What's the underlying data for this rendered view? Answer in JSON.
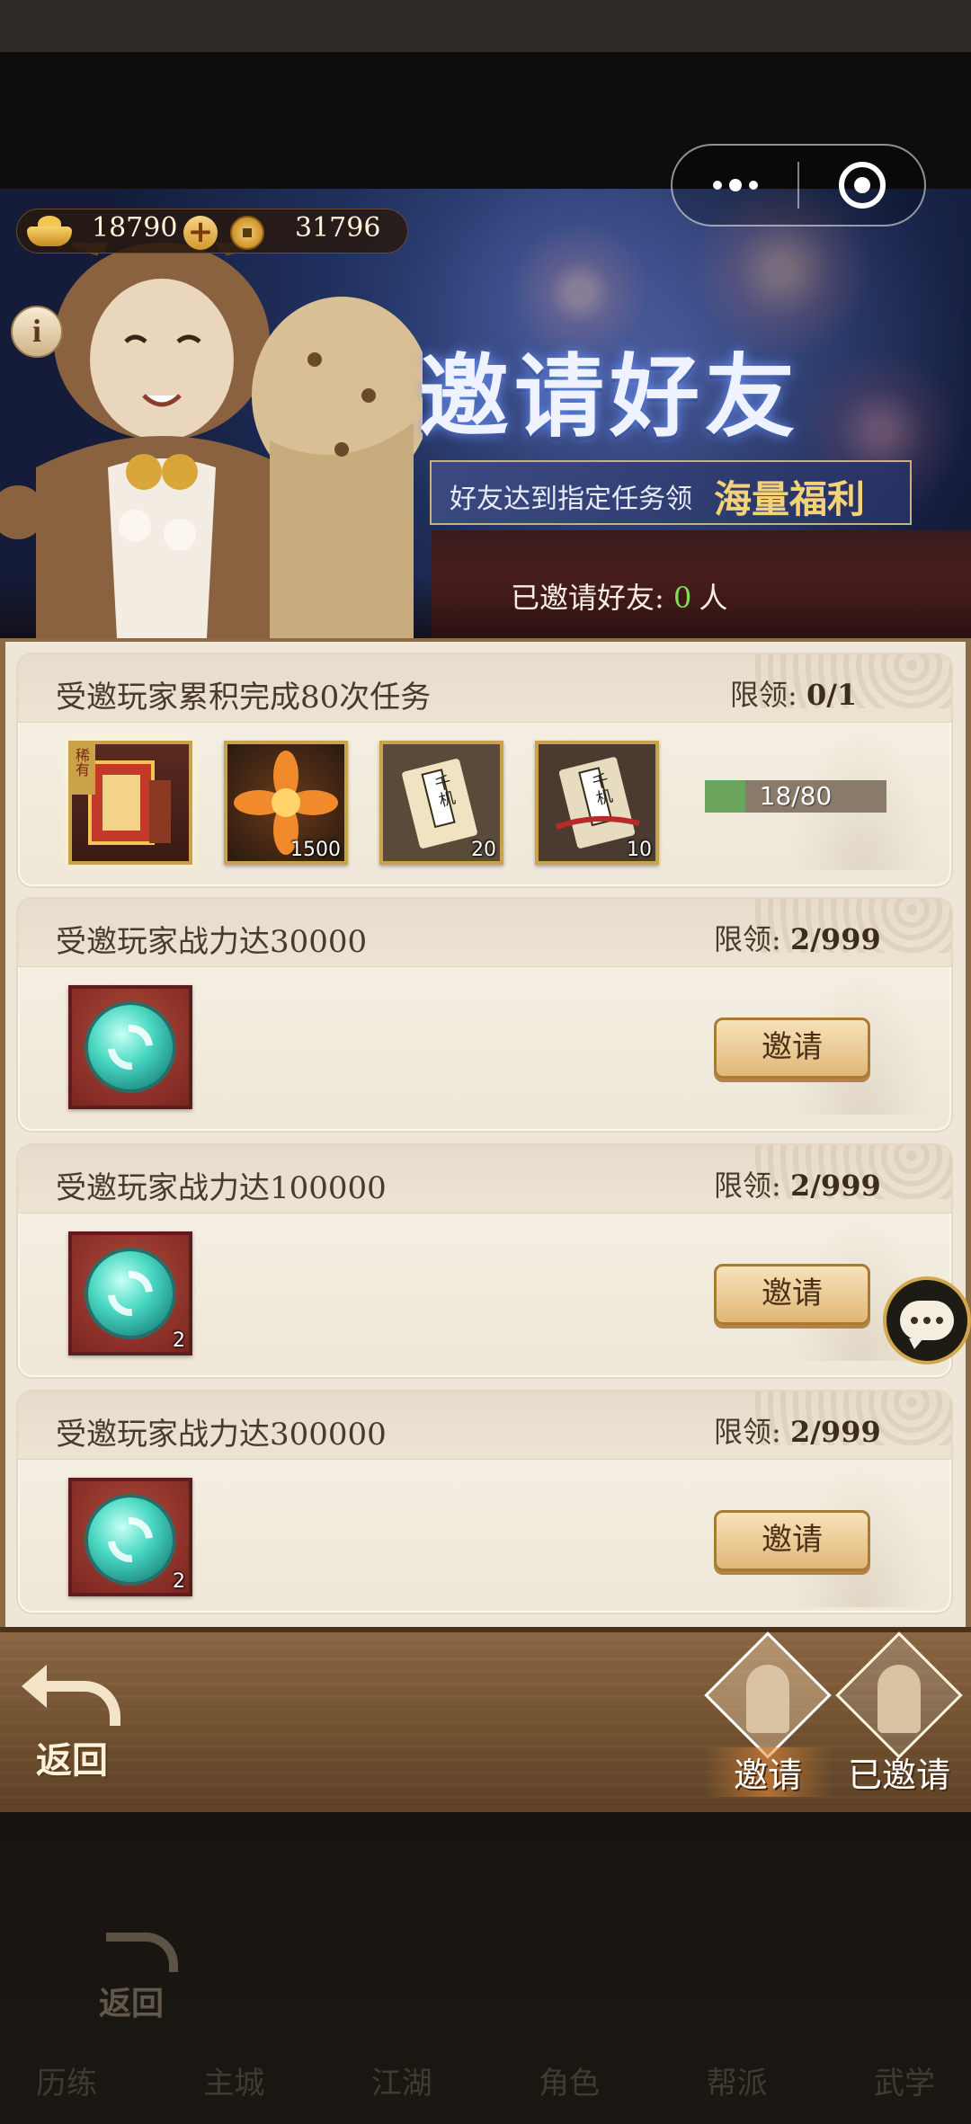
{
  "currency": {
    "gold": "18790",
    "coins": "31796",
    "gold_icon": "gold-ingot-icon",
    "coin_icon": "copper-coin-icon",
    "plus_symbol": "+"
  },
  "capsule": {
    "more_icon": "more-dots-icon",
    "close_icon": "target-close-icon"
  },
  "info_symbol": "i",
  "banner": {
    "title": "邀请好友",
    "subtitle_prefix": "好友达到指定任务领",
    "subtitle_emphasis": "海量福利",
    "invited_label": "已邀请好友: ",
    "invited_count": "0",
    "invited_unit": "人"
  },
  "limit_label": "限领:",
  "invite_label": "邀请",
  "tasks": [
    {
      "title": "受邀玩家累积完成80次任务",
      "limit": "0/1",
      "rewards": [
        {
          "icon": "rare-book-icon",
          "qty": "",
          "badge": "稀有"
        },
        {
          "icon": "flame-flower-icon",
          "qty": "1500"
        },
        {
          "icon": "scroll-card-icon",
          "qty": "20"
        },
        {
          "icon": "scroll-card-ribbon-icon",
          "qty": "10"
        }
      ],
      "progress_text": "18/80",
      "progress": 0.225
    },
    {
      "title": "受邀玩家战力达30000",
      "limit": "2/999",
      "rewards": [
        {
          "icon": "refresh-orb-icon",
          "qty": ""
        }
      ]
    },
    {
      "title": "受邀玩家战力达100000",
      "limit": "2/999",
      "rewards": [
        {
          "icon": "refresh-orb-icon",
          "qty": "2"
        }
      ]
    },
    {
      "title": "受邀玩家战力达300000",
      "limit": "2/999",
      "rewards": [
        {
          "icon": "refresh-orb-icon",
          "qty": "2"
        }
      ]
    }
  ],
  "scroll_label": "千机",
  "bottom": {
    "back_label": "返回",
    "tab_invite": "邀请",
    "tab_invited": "已邀请"
  },
  "background": {
    "back_label": "返回",
    "nav": [
      "历练",
      "主城",
      "江湖",
      "角色",
      "帮派",
      "武学"
    ]
  },
  "colors": {
    "accent_gold": "#c9a24a",
    "progress_green": "#6aa35b",
    "invited_count_green": "#7ee05a"
  }
}
